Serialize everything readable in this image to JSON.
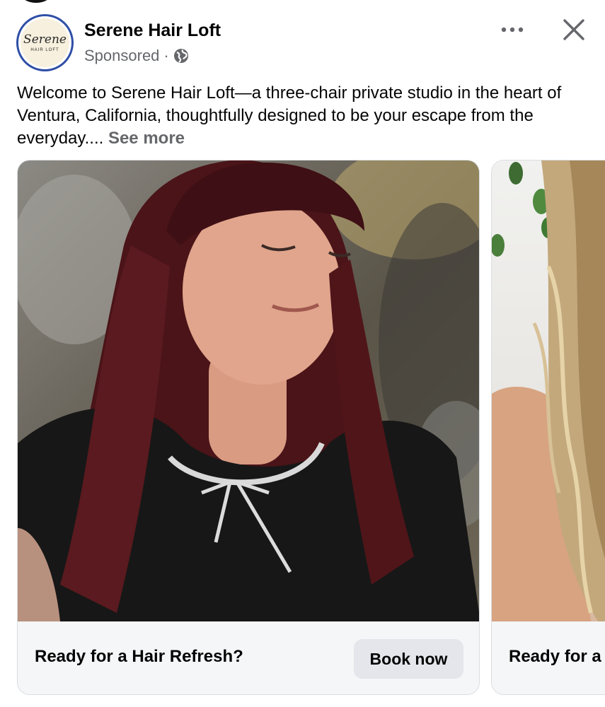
{
  "post": {
    "page_name": "Serene Hair Loft",
    "sponsored_label": "Sponsored",
    "separator": "·",
    "avatar_logo_script": "Serene",
    "avatar_logo_sub": "HAIR LOFT",
    "body_text": "Welcome to Serene Hair Loft—a three-chair private studio in the heart of Ventura, California, thoughtfully designed to be your escape from the everyday....",
    "see_more_label": "See more"
  },
  "carousel": {
    "cards": [
      {
        "title": "Ready for a Hair Refresh?",
        "cta_label": "Book now"
      },
      {
        "title": "Ready for a"
      }
    ]
  },
  "icons": {
    "privacy": "globe-icon",
    "more": "more-options-icon",
    "close": "close-icon"
  },
  "colors": {
    "avatar_ring": "#2f4fa6",
    "secondary_text": "#65676b",
    "button_bg": "#e4e6eb",
    "footer_bg": "#f5f6f7"
  }
}
